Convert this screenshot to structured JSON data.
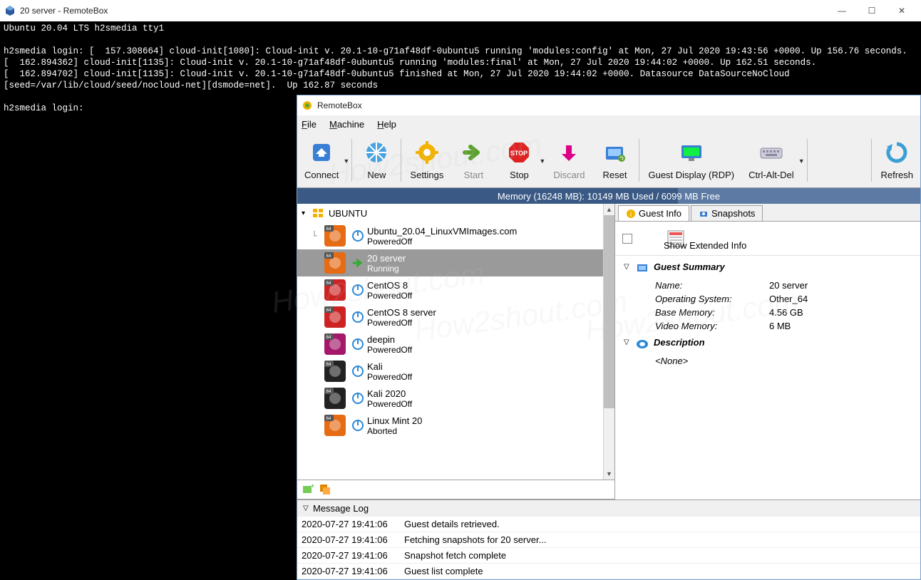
{
  "outer": {
    "title": "20 server - RemoteBox",
    "min": "—",
    "max": "☐",
    "close": "✕"
  },
  "terminal_lines": [
    "Ubuntu 20.04 LTS h2smedia tty1",
    "",
    "h2smedia login: [  157.308664] cloud-init[1080]: Cloud-init v. 20.1-10-g71af48df-0ubuntu5 running 'modules:config' at Mon, 27 Jul 2020 19:43:56 +0000. Up 156.76 seconds.",
    "[  162.894362] cloud-init[1135]: Cloud-init v. 20.1-10-g71af48df-0ubuntu5 running 'modules:final' at Mon, 27 Jul 2020 19:44:02 +0000. Up 162.51 seconds.",
    "[  162.894702] cloud-init[1135]: Cloud-init v. 20.1-10-g71af48df-0ubuntu5 finished at Mon, 27 Jul 2020 19:44:02 +0000. Datasource DataSourceNoCloud [seed=/var/lib/cloud/seed/nocloud-net][dsmode=net].  Up 162.87 seconds",
    "",
    "h2smedia login:"
  ],
  "rb": {
    "title": "RemoteBox",
    "menu": {
      "file": "File",
      "machine": "Machine",
      "help": "Help"
    },
    "toolbar": {
      "connect": "Connect",
      "new": "New",
      "settings": "Settings",
      "start": "Start",
      "stop": "Stop",
      "discard": "Discard",
      "reset": "Reset",
      "gdisplay": "Guest Display (RDP)",
      "cad": "Ctrl-Alt-Del",
      "refresh": "Refresh"
    },
    "memory": {
      "label": "Memory (16248 MB): 10149 MB Used / 6099 MB Free",
      "used_pct": 62
    },
    "group": "UBUNTU",
    "vms": [
      {
        "name": "Ubuntu_20.04_LinuxVMImages.com",
        "state": "PoweredOff",
        "selected": false,
        "running": false
      },
      {
        "name": "20 server",
        "state": "Running",
        "selected": true,
        "running": true
      },
      {
        "name": "CentOS 8",
        "state": "PoweredOff",
        "selected": false,
        "running": false
      },
      {
        "name": "CentOS 8 server",
        "state": "PoweredOff",
        "selected": false,
        "running": false
      },
      {
        "name": "deepin",
        "state": "PoweredOff",
        "selected": false,
        "running": false
      },
      {
        "name": "Kali",
        "state": "PoweredOff",
        "selected": false,
        "running": false
      },
      {
        "name": "Kali 2020",
        "state": "PoweredOff",
        "selected": false,
        "running": false
      },
      {
        "name": "Linux Mint 20",
        "state": "Aborted",
        "selected": false,
        "running": false
      }
    ],
    "tabs": {
      "info": "Guest Info",
      "snapshots": "Snapshots"
    },
    "show_ext": "Show Extended Info",
    "summary": {
      "title": "Guest Summary",
      "name_k": "Name:",
      "name_v": "20 server",
      "os_k": "Operating System:",
      "os_v": "Other_64",
      "mem_k": "Base Memory:",
      "mem_v": "4.56 GB",
      "vmem_k": "Video Memory:",
      "vmem_v": "6 MB"
    },
    "desc": {
      "title": "Description",
      "value": "<None>"
    },
    "log_header": "Message Log",
    "log": [
      {
        "ts": "2020-07-27 19:41:06",
        "msg": "Guest details retrieved."
      },
      {
        "ts": "2020-07-27 19:41:06",
        "msg": "Fetching snapshots for 20 server..."
      },
      {
        "ts": "2020-07-27 19:41:06",
        "msg": "Snapshot fetch complete"
      },
      {
        "ts": "2020-07-27 19:41:06",
        "msg": "Guest list complete"
      }
    ]
  }
}
